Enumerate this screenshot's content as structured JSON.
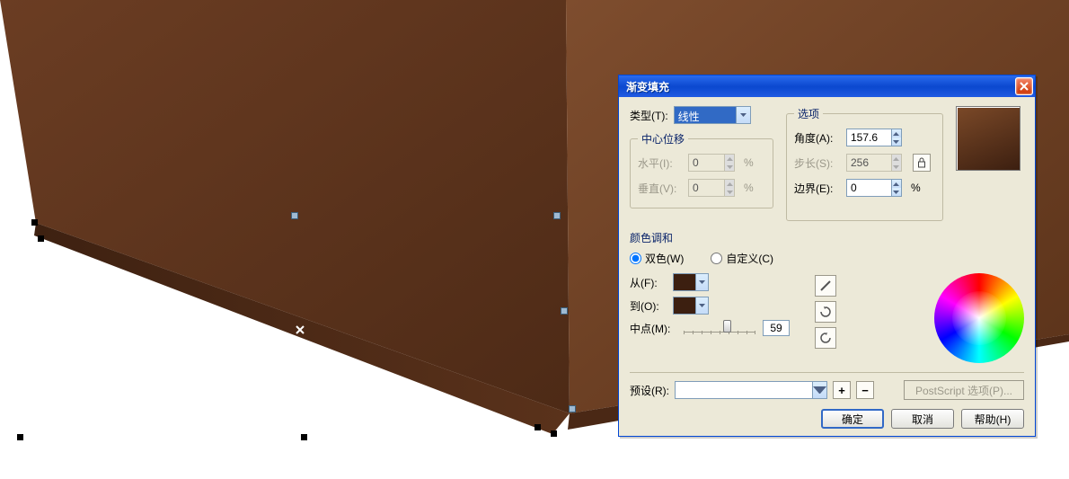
{
  "dialog": {
    "title": "渐变填充",
    "type_label": "类型(T):",
    "type_value": "线性",
    "center_offset_title": "中心位移",
    "horiz_label": "水平(I):",
    "horiz_value": "0",
    "vert_label": "垂直(V):",
    "vert_value": "0",
    "options_title": "选项",
    "angle_label": "角度(A):",
    "angle_value": "157.6",
    "step_label": "步长(S):",
    "step_value": "256",
    "edge_label": "边界(E):",
    "edge_value": "0",
    "blend_title": "颜色调和",
    "radio_two": "双色(W)",
    "radio_custom": "自定义(C)",
    "from_label": "从(F):",
    "to_label": "到(O):",
    "mid_label": "中点(M):",
    "mid_value": "59",
    "preset_label": "预设(R):",
    "ps_label": "PostScript 选项(P)...",
    "ok": "确定",
    "cancel": "取消",
    "help": "帮助(H)",
    "pct": "%",
    "plus": "+",
    "minus": "−"
  },
  "colors": {
    "from": "#3c1f10",
    "to": "#3c1f10"
  }
}
